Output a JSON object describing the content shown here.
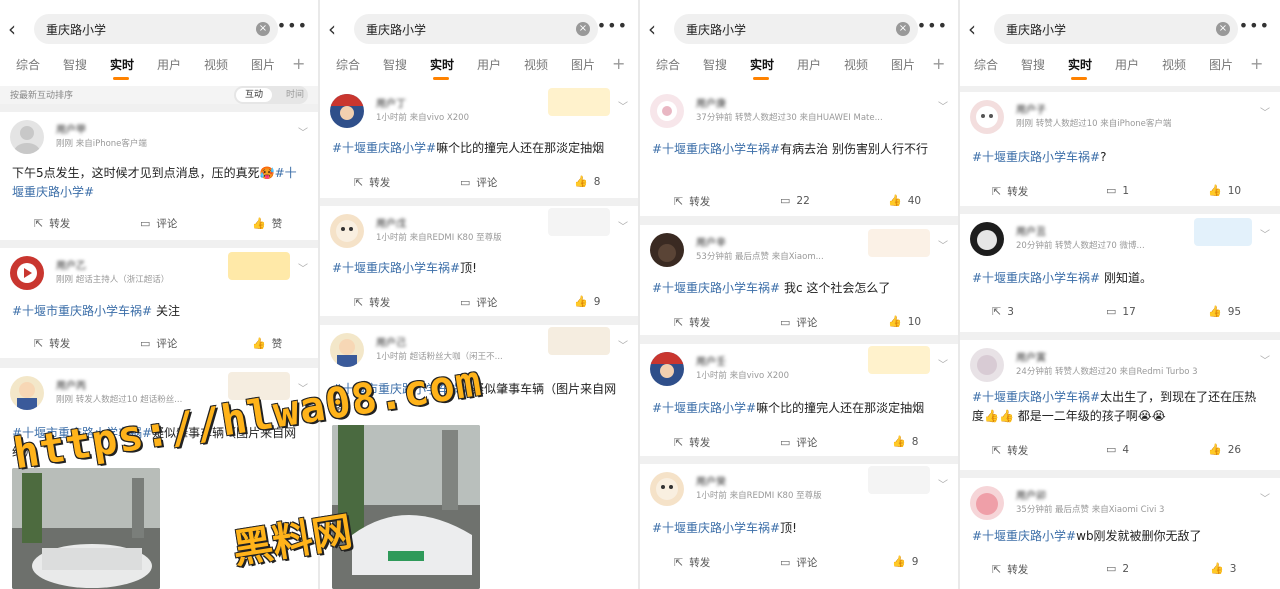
{
  "search_query": "重庆路小学",
  "tabs": [
    "综合",
    "智搜",
    "实时",
    "用户",
    "视频",
    "图片"
  ],
  "sort": {
    "label": "按最新互动排序",
    "option_on": "互动",
    "option_off": "时间"
  },
  "actions": {
    "repost": "转发",
    "comment": "评论",
    "like": "赞"
  },
  "watermark": {
    "url": "https://hlwa08.com",
    "site": "黑料网"
  },
  "colors": {
    "accent": "#ff8200",
    "link": "#3b6ea8"
  },
  "panels": [
    {
      "posts": [
        {
          "user": "用户甲",
          "meta": "刚刚  来自iPhone客户端",
          "prefix": "下午5点发生，这时候才见到点消息，压的真死🥵",
          "tag": "#十堰重庆路小学#",
          "suffix": "",
          "repost": "转发",
          "comment": "评论",
          "like": "赞"
        },
        {
          "user": "用户乙",
          "meta": "刚刚  超话主持人（浙江超话）",
          "prefix": "",
          "tag": "#十堰市重庆路小学车祸#",
          "suffix": " 关注",
          "repost": "转发",
          "comment": "评论",
          "like": "赞"
        },
        {
          "user": "用户丙",
          "meta": "刚刚  转发人数超过10  超话粉丝...",
          "prefix": "",
          "tag": "#十堰市重庆路小学车祸#",
          "suffix": "疑似肇事车辆（图片来自网络）"
        }
      ]
    },
    {
      "posts": [
        {
          "user": "用户丁",
          "meta": "1小时前  来自vivo X200",
          "prefix": "",
          "tag": "#十堰重庆路小学#",
          "suffix": "嘛个比的撞完人还在那淡定抽烟",
          "repost": "转发",
          "comment": "评论",
          "like": "8"
        },
        {
          "user": "用户戊",
          "meta": "1小时前  来自REDMI K80 至尊版",
          "prefix": "",
          "tag": "#十堰重庆路小学车祸#",
          "suffix": "顶!",
          "repost": "转发",
          "comment": "评论",
          "like": "9"
        },
        {
          "user": "用户己",
          "meta": "1小时前  超话粉丝大咖（闲王不...",
          "prefix": "",
          "tag": "#十堰市重庆路小学车祸#",
          "suffix": "疑似肇事车辆（图片来自网络）"
        }
      ]
    },
    {
      "posts": [
        {
          "user": "用户庚",
          "meta": "37分钟前  转赞人数超过30  来自HUAWEI Mate...",
          "prefix": "",
          "tag": "#十堰重庆路小学车祸#",
          "suffix": "有病去治 别伤害别人行不行",
          "repost": "转发",
          "comment": "22",
          "like": "40"
        },
        {
          "user": "用户辛",
          "meta": "53分钟前  最后点赞  来自Xiaom...",
          "prefix": "",
          "tag": "#十堰重庆路小学车祸#",
          "suffix": " 我c 这个社会怎么了",
          "repost": "转发",
          "comment": "评论",
          "like": "10"
        },
        {
          "user": "用户壬",
          "meta": "1小时前  来自vivo X200",
          "prefix": "",
          "tag": "#十堰重庆路小学#",
          "suffix": "嘛个比的撞完人还在那淡定抽烟",
          "repost": "转发",
          "comment": "评论",
          "like": "8"
        },
        {
          "user": "用户癸",
          "meta": "1小时前  来自REDMI K80 至尊版",
          "prefix": "",
          "tag": "#十堰重庆路小学车祸#",
          "suffix": "顶!",
          "repost": "转发",
          "comment": "评论",
          "like": "9"
        }
      ]
    },
    {
      "posts": [
        {
          "user": "用户子",
          "meta": "刚刚  转赞人数超过10  来自iPhone客户端",
          "prefix": "",
          "tag": "#十堰重庆路小学车祸#",
          "suffix": "?",
          "repost": "转发",
          "comment": "1",
          "like": "10"
        },
        {
          "user": "用户丑",
          "meta": "20分钟前  转赞人数超过70  微博...",
          "prefix": "",
          "tag": "#十堰重庆路小学车祸#",
          "suffix": " 刚知道。",
          "repost": "3",
          "comment": "17",
          "like": "95"
        },
        {
          "user": "用户寅",
          "meta": "24分钟前  转赞人数超过20  来自Redmi Turbo 3",
          "prefix": "",
          "tag": "#十堰重庆路小学车祸#",
          "suffix": "太出生了，到现在了还在压热度👍👍 都是一二年级的孩子啊😭😭",
          "repost": "转发",
          "comment": "4",
          "like": "26"
        },
        {
          "user": "用户卯",
          "meta": "35分钟前  最后点赞  来自Xiaomi Civi 3",
          "prefix": "",
          "tag": "#十堰重庆路小学#",
          "suffix": "wb刚发就被删你无敌了",
          "repost": "转发",
          "comment": "2",
          "like": "3"
        }
      ]
    }
  ]
}
